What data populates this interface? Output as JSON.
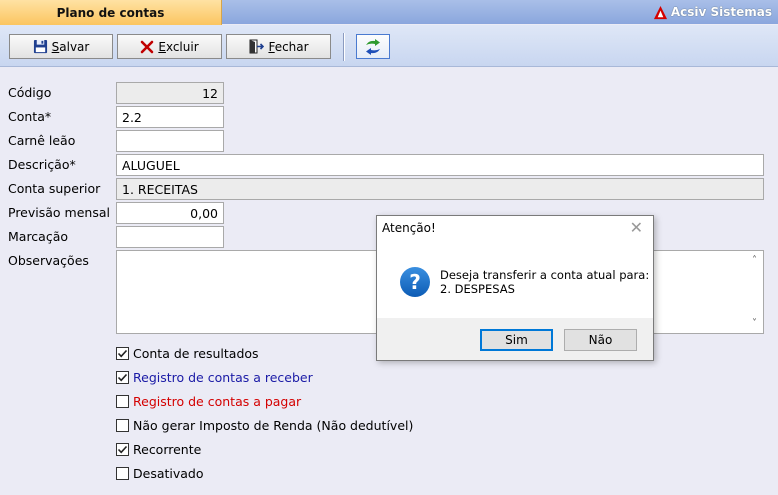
{
  "window": {
    "tab_title": "Plano de contas",
    "brand": "Acsiv Sistemas"
  },
  "toolbar": {
    "save_mnemonic": "S",
    "save_rest": "alvar",
    "delete_mnemonic": "E",
    "delete_rest": "xcluir",
    "close_mnemonic": "F",
    "close_rest": "echar",
    "transfer_icon": "transfer-arrows-icon"
  },
  "form": {
    "codigo_label": "Código",
    "codigo_value": "12",
    "conta_label": "Conta*",
    "conta_value": "2.2",
    "carne_label": "Carnê leão",
    "carne_value": "",
    "descricao_label": "Descrição*",
    "descricao_value": "ALUGUEL",
    "superior_label": "Conta superior",
    "superior_value": "1. RECEITAS",
    "previsao_label": "Previsão mensal",
    "previsao_value": "0,00",
    "marcacao_label": "Marcação",
    "marcacao_value": "",
    "obs_label": "Observações",
    "obs_value": ""
  },
  "checkboxes": [
    {
      "label": "Conta de resultados",
      "checked": true,
      "color": "#000000"
    },
    {
      "label": "Registro de contas a receber",
      "checked": true,
      "color": "#1a1aa6"
    },
    {
      "label": "Registro de contas a pagar",
      "checked": false,
      "color": "#d40000"
    },
    {
      "label": "Não gerar Imposto de Renda (Não dedutível)",
      "checked": false,
      "color": "#000000"
    },
    {
      "label": "Recorrente",
      "checked": true,
      "color": "#000000"
    },
    {
      "label": "Desativado",
      "checked": false,
      "color": "#000000"
    }
  ],
  "dialog": {
    "title": "Atenção!",
    "message_line1": "Deseja transferir a conta atual para:",
    "message_line2": "2. DESPESAS",
    "yes_label": "Sim",
    "no_label": "Não",
    "icon": "question-icon"
  },
  "colors": {
    "accent": "#0078d7",
    "tab": "#fbc560",
    "brand_red": "#d40000"
  }
}
